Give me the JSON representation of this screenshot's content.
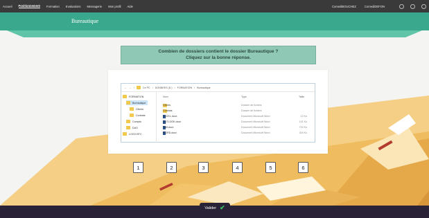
{
  "topnav": {
    "items": [
      "Accueil",
      "Positionnement",
      "Formation",
      "Evaluations",
      "Messagerie",
      "Mon profil",
      "Aide"
    ],
    "active_index": 1,
    "user_1": "ComediBOUCHEZ",
    "user_2": "ComediDEFON"
  },
  "header": {
    "title": "Bureautique"
  },
  "question": {
    "line1": "Combien de dossiers contient le dossier Bureautique ?",
    "line2": "Cliquez sur la bonne réponse."
  },
  "explorer": {
    "breadcrumb": [
      "Ce PC",
      "DONNEES (D:)",
      "FORMATION",
      "Bureautique"
    ],
    "columns": {
      "name": "Nom",
      "type": "Type",
      "size": "Taille"
    },
    "tree": [
      {
        "label": "FORMATION",
        "indent": 0,
        "selected": false
      },
      {
        "label": "Bureautique",
        "indent": 1,
        "selected": true
      },
      {
        "label": "Clients",
        "indent": 2,
        "selected": false
      },
      {
        "label": "Contrats",
        "indent": 2,
        "selected": false
      },
      {
        "label": "Compta",
        "indent": 1,
        "selected": false
      },
      {
        "label": "DAO",
        "indent": 1,
        "selected": false
      },
      {
        "label": "LOGO BTC",
        "indent": 0,
        "selected": false
      }
    ],
    "files": [
      {
        "name": "Clients",
        "kind": "folder",
        "type": "Dossier de fichiers",
        "size": ""
      },
      {
        "name": "Contrats",
        "kind": "folder",
        "type": "Dossier de fichiers",
        "size": ""
      },
      {
        "name": "EXCEL.docx",
        "kind": "doc",
        "type": "Document Microsoft Word",
        "size": "13 Ko"
      },
      {
        "name": "OUTLOOK.docx",
        "kind": "doc",
        "type": "Document Microsoft Word",
        "size": "101 Ko"
      },
      {
        "name": "Tarif.docx",
        "kind": "doc",
        "type": "Document Microsoft Word",
        "size": "733 Ko"
      },
      {
        "name": "WORD.docx",
        "kind": "doc",
        "type": "Document Microsoft Word",
        "size": "304 Ko"
      }
    ]
  },
  "answers": [
    "1",
    "2",
    "3",
    "4",
    "5",
    "6"
  ],
  "submit": {
    "label": "Valider",
    "icon": "checkmark-icon"
  },
  "colors": {
    "header": "#3aa88c",
    "question_bg": "#8fc8b4",
    "nav_bg": "#3a3a3a",
    "bottom_bar": "#2a2337",
    "check": "#3fc46b",
    "folder": "#f2c94c"
  }
}
